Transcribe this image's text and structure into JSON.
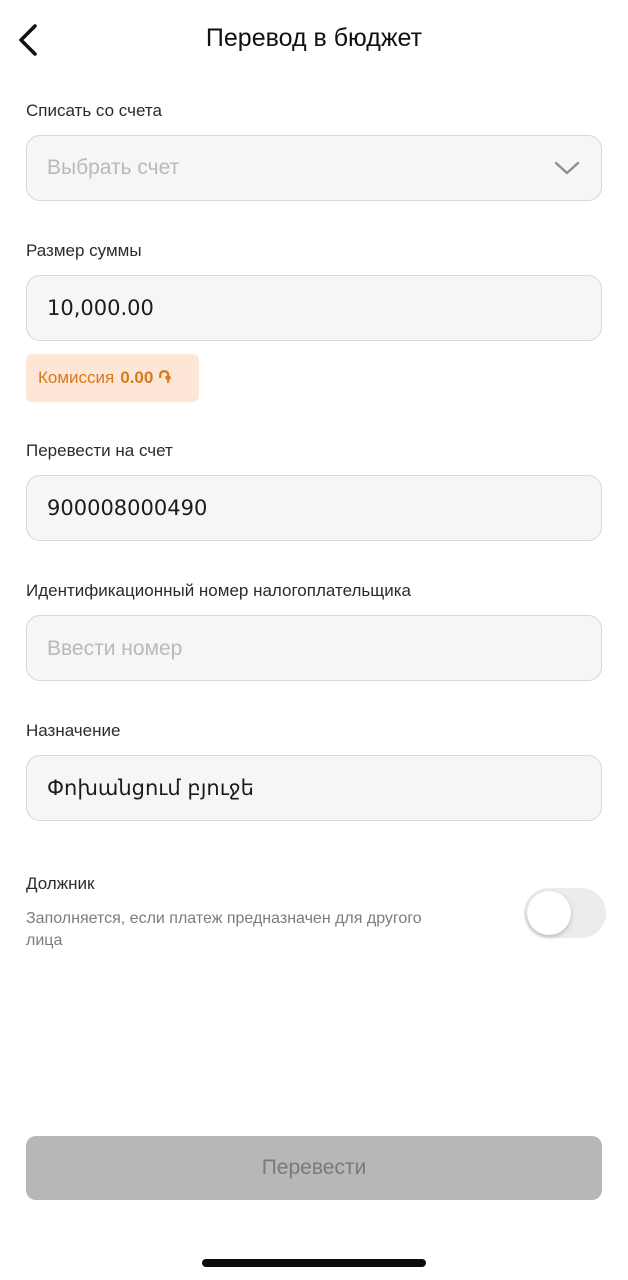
{
  "header": {
    "title": "Перевод в бюджет"
  },
  "source_account": {
    "label": "Списать со счета",
    "placeholder": "Выбрать счет"
  },
  "amount": {
    "label": "Размер суммы",
    "value": "10,000.00"
  },
  "commission": {
    "label": "Комиссия",
    "value": "0.00",
    "currency": "֏"
  },
  "target_account": {
    "label": "Перевести на счет",
    "value": "900008000490"
  },
  "tax_id": {
    "label": "Идентификационный номер налогоплательщика",
    "placeholder": "Ввести номер"
  },
  "purpose": {
    "label": "Назначение",
    "value": "Փոխանցում բյուջե"
  },
  "debtor": {
    "title": "Должник",
    "description": "Заполняется, если платеж предназначен для другого лица",
    "enabled": false
  },
  "submit": {
    "label": "Перевести"
  },
  "icons": {
    "back": "chevron-left-icon",
    "dropdown": "chevron-down-icon"
  },
  "colors": {
    "commission_bg": "#fde6d5",
    "commission_text": "#d9791e",
    "button_disabled": "#b7b7b9"
  }
}
